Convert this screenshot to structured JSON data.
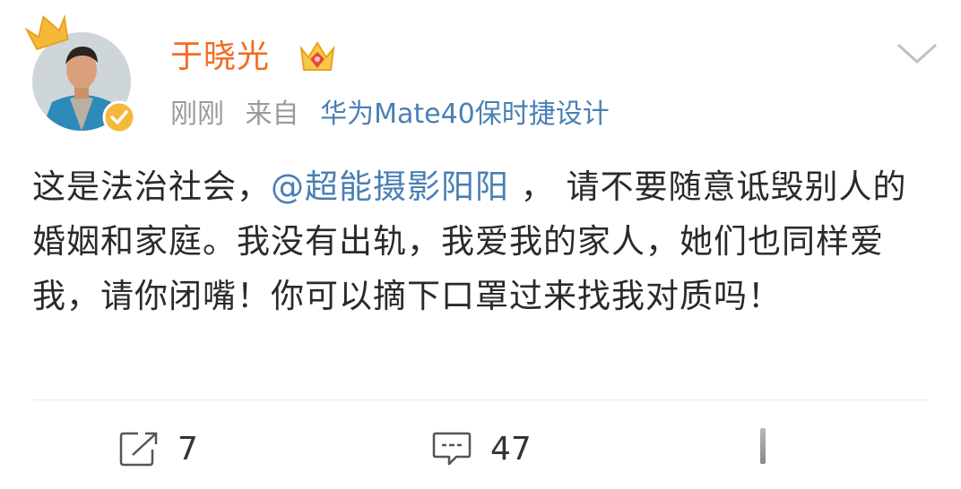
{
  "user": {
    "name": "于晓光",
    "avatar_icon": "user-avatar-photo",
    "vip_icon": "vip-crown-icon",
    "verified_icon": "verified-badge-icon"
  },
  "meta": {
    "time": "刚刚",
    "from_label": "来自",
    "source": "华为Mate40保时捷设计"
  },
  "content": {
    "part1": "这是法治社会，",
    "mention": "@超能摄影阳阳",
    "part2": " ， 请不要随意诋毁别人的婚姻和家庭。我没有出轨，我爱我的家人，她们也同样爱我，请你闭嘴！你可以摘下口罩过来找我对质吗！"
  },
  "actions": {
    "repost_count": "7",
    "comment_count": "47"
  },
  "colors": {
    "username": "#f26b21",
    "link": "#4a7fb5",
    "meta_gray": "#9a9a9a",
    "text": "#2a2a2a"
  }
}
